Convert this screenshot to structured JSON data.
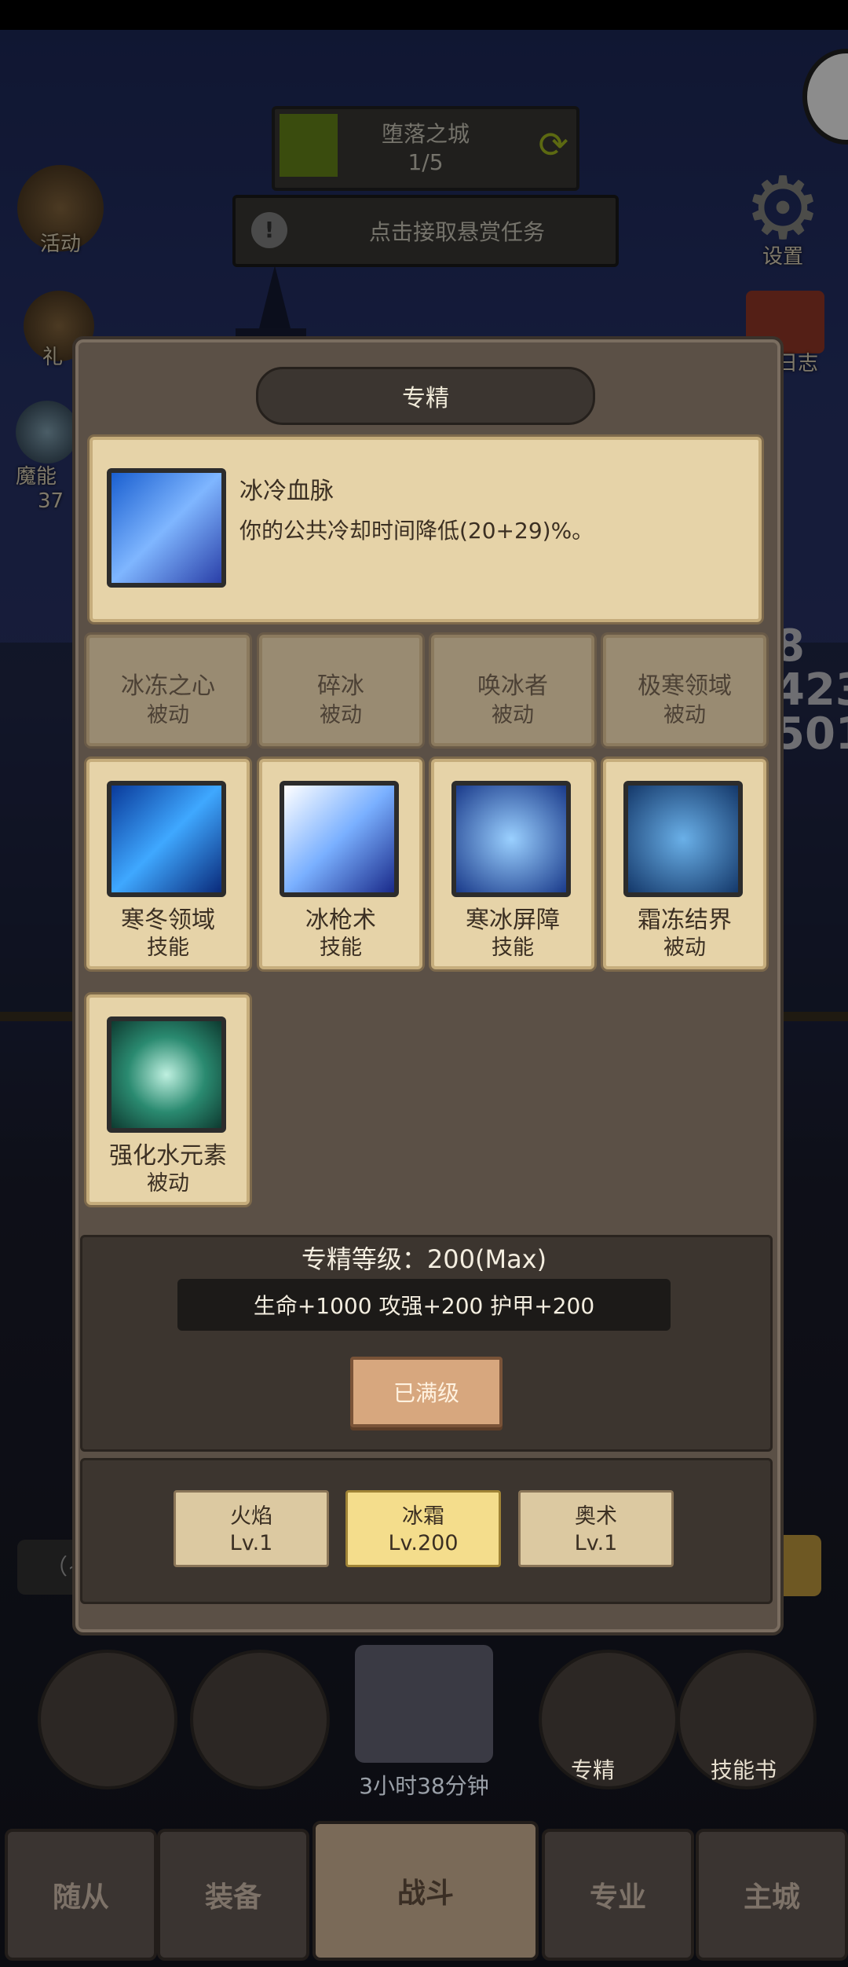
{
  "hud": {
    "zone_name": "堕落之城",
    "zone_progress": "1/5",
    "bounty_label": "点击接取悬赏任务",
    "left_buttons": [
      {
        "label": "活动"
      },
      {
        "label": "礼"
      },
      {
        "label": "魔能",
        "sub": "37"
      }
    ],
    "right_buttons": [
      {
        "label": "设置"
      },
      {
        "label": "日志"
      }
    ],
    "bg_digits": [
      "8",
      "423",
      "501"
    ],
    "left_bar_text": "（~"
  },
  "dialog": {
    "title": "专精",
    "detail": {
      "name": "冰冷血脉",
      "description": "你的公共冷却时间降低(20+29)%。"
    },
    "faded_row": [
      {
        "name": "冰冻之心",
        "type": "被动"
      },
      {
        "name": "碎冰",
        "type": "被动"
      },
      {
        "name": "唤冰者",
        "type": "被动"
      },
      {
        "name": "极寒领域",
        "type": "被动"
      }
    ],
    "skills": [
      {
        "name": "寒冬领域",
        "type": "技能"
      },
      {
        "name": "冰枪术",
        "type": "技能"
      },
      {
        "name": "寒冰屏障",
        "type": "技能"
      },
      {
        "name": "霜冻结界",
        "type": "被动"
      },
      {
        "name": "强化水元素",
        "type": "被动"
      }
    ],
    "level_text": "专精等级：200(Max)",
    "bonus_text": "生命+1000  攻强+200  护甲+200",
    "max_button": "已满级",
    "tabs": [
      {
        "name": "火焰",
        "level": "Lv.1"
      },
      {
        "name": "冰霜",
        "level": "Lv.200"
      },
      {
        "name": "奥术",
        "level": "Lv.1"
      }
    ]
  },
  "bottom": {
    "timer": "3小时38分钟",
    "spec_label": "专精",
    "skillbook_label": "技能书",
    "nav": [
      "随从",
      "装备",
      "战斗",
      "专业",
      "主城"
    ]
  },
  "colors": {
    "parchment": "#e6d3a8",
    "active_tab": "#f4dd8c",
    "dialog": "#5b5046"
  }
}
